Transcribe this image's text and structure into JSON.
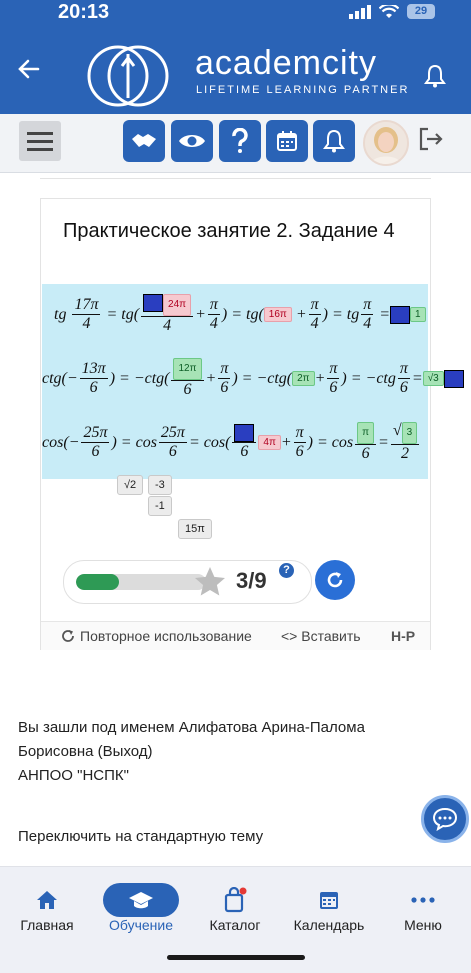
{
  "status": {
    "time": "20:13",
    "battery": "29"
  },
  "header": {
    "brand": "academcity",
    "tagline": "LIFETIME LEARNING PARTNER"
  },
  "card": {
    "title": "Практическое занятие 2. Задание 4",
    "tiles": {
      "t24pi": "24π",
      "t16pi": "16π",
      "t1": "1",
      "t12pi": "12π",
      "t2pi": "2π",
      "tsqrt3": "√3",
      "t4pi": "4π",
      "tpi": "π",
      "t3": "3",
      "penalty": "-1"
    },
    "pool": [
      "√2",
      "-3",
      "-1",
      "15π"
    ],
    "progress": {
      "fraction": 0.333,
      "score": "3/9",
      "help": "?"
    },
    "footer": {
      "reuse": "Повторное использование",
      "embed": "<> Вставить",
      "logo": "H-P"
    }
  },
  "login": {
    "line1": "Вы зашли под именем Алифатова Арина-Палома",
    "line2": "Борисовна (Выход)",
    "line3": "АНПОО \"НСПК\""
  },
  "switch_theme": "Переключить на стандартную тему",
  "nav": {
    "home": "Главная",
    "learning": "Обучение",
    "catalog": "Каталог",
    "calendar": "Календарь",
    "menu": "Меню"
  }
}
